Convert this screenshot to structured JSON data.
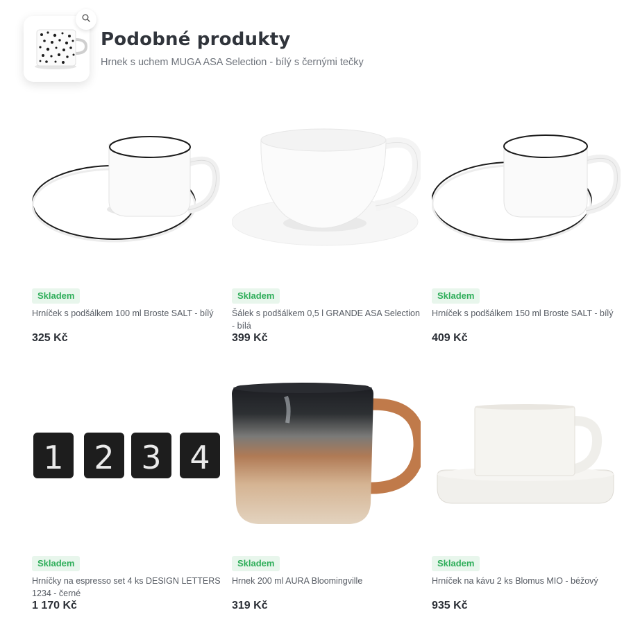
{
  "header": {
    "title": "Podobné produkty",
    "subtitle": "Hrnek s uchem MUGA ASA Selection - bílý s černými tečky",
    "zoom_icon": "search-icon"
  },
  "colors": {
    "stock_badge_bg": "#e8f6ec",
    "stock_badge_text": "#2fae5a",
    "price_text": "#2b2f36"
  },
  "products": [
    {
      "availability": "Skladem",
      "name": "Hrníček s podšálkem 100 ml Broste SALT - bílý",
      "price": "325 Kč"
    },
    {
      "availability": "Skladem",
      "name": "Šálek s podšálkem 0,5 l GRANDE ASA Selection - bílá",
      "price": "399 Kč"
    },
    {
      "availability": "Skladem",
      "name": "Hrníček s podšálkem 150 ml Broste SALT - bílý",
      "price": "409 Kč"
    },
    {
      "availability": "Skladem",
      "name": "Hrníčky na espresso set 4 ks DESIGN LETTERS 1234 - černé",
      "price": "1 170 Kč",
      "digits": [
        "1",
        "2",
        "3",
        "4"
      ]
    },
    {
      "availability": "Skladem",
      "name": "Hrnek 200 ml AURA Bloomingville",
      "price": "319 Kč"
    },
    {
      "availability": "Skladem",
      "name": "Hrníček na kávu 2 ks Blomus MIO - béžový",
      "price": "935 Kč"
    }
  ]
}
